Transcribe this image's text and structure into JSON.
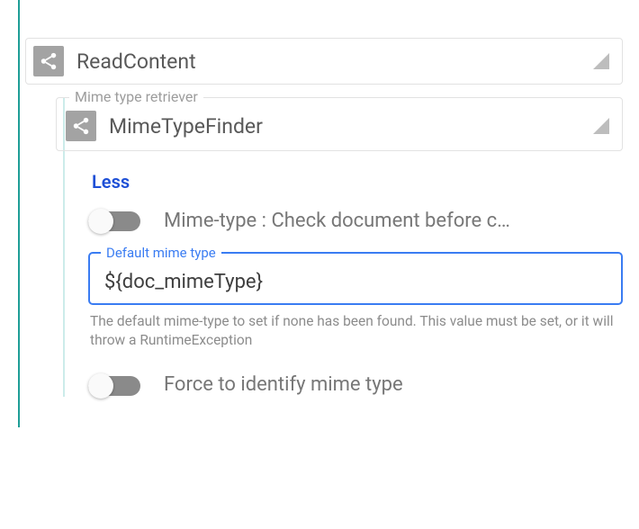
{
  "main_card": {
    "title": "ReadContent"
  },
  "mime_retriever": {
    "legend": "Mime type retriever",
    "title": "MimeTypeFinder"
  },
  "details": {
    "toggle_label": "Less",
    "check_before": {
      "label": "Mime-type : Check document before c…",
      "on": false
    },
    "default_mime": {
      "legend": "Default mime type",
      "value": "${doc_mimeType}",
      "help": "The default mime-type to set if none has been found. This value must be set, or it will throw a RuntimeException"
    },
    "force_identify": {
      "label": "Force to identify mime type",
      "on": false
    }
  }
}
